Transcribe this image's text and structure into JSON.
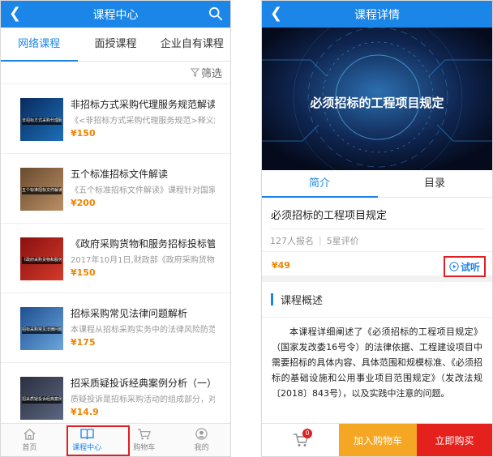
{
  "left": {
    "header": {
      "title": "课程中心"
    },
    "tabs": [
      {
        "label": "网络课程"
      },
      {
        "label": "面授课程"
      },
      {
        "label": "企业自有课程"
      }
    ],
    "filter_label": "筛选",
    "courses": [
      {
        "title": "非招标方式采购代理服务规范解读（",
        "desc": "《<非招标方式采购代理服务规范>释义解",
        "price": "¥150",
        "thumb_caption": "非招标方式采购代理服务规范解读（二）",
        "thumb_colors": [
          "#0a2a5e",
          "#1d6fb8"
        ]
      },
      {
        "title": "五个标准招标文件解读",
        "desc": "《五个标准招标文件解读》课程针对国家发",
        "price": "¥200",
        "thumb_caption": "五个标准招标文件解读",
        "thumb_colors": [
          "#6b4a2e",
          "#b89067"
        ]
      },
      {
        "title": "《政府采购货物和服务招标投标管理",
        "desc": "2017年10月1日,财政部《政府采购货物和服",
        "price": "¥150",
        "thumb_caption": "《政府采购货物和服务招标投标管理办法》解读",
        "thumb_colors": [
          "#8a1010",
          "#d43a2a"
        ]
      },
      {
        "title": "招标采购常见法律问题解析",
        "desc": "本课程从招标采购实务中的法律风险防范和",
        "price": "¥175",
        "thumb_caption": "招标采购常见法律问题解析",
        "thumb_colors": [
          "#1e4f8f",
          "#6aa6dd"
        ]
      },
      {
        "title": "招采质疑投诉经典案例分析（一）",
        "desc": "质疑投诉是招标采购活动的组成部分，对于",
        "price": "¥14.9",
        "thumb_caption": "招采质疑投诉经典案例分析（一）",
        "thumb_colors": [
          "#2b2f40",
          "#5c6780"
        ]
      }
    ],
    "bottom_nav": [
      {
        "label": "首页",
        "icon": "home-icon"
      },
      {
        "label": "课程中心",
        "icon": "book-icon"
      },
      {
        "label": "购物车",
        "icon": "cart-icon"
      },
      {
        "label": "我的",
        "icon": "user-icon"
      }
    ]
  },
  "right": {
    "header": {
      "title": "课程详情"
    },
    "banner_title": "必须招标的工程项目规定",
    "tabs": [
      {
        "label": "简介"
      },
      {
        "label": "目录"
      }
    ],
    "course_title": "必须招标的工程项目规定",
    "enrolled": "127人报名",
    "rating": "5星评价",
    "price": "¥49",
    "trial_label": "试听",
    "overview_heading": "课程概述",
    "overview_text": "本课程详细阐述了《必须招标的工程项目规定》（国家发改委16号令）的法律依据、工程建设项目中需要招标的具体内容、具体范围和规模标准、《必须招标的基础设施和公用事业项目范围规定》（发改法规〔2018〕843号），以及实践中注意的问题。",
    "cart_count": "0",
    "add_to_cart": "加入购物车",
    "buy_now": "立即购买"
  },
  "colors": {
    "primary": "#1b86e8",
    "price": "#f08300",
    "highlight_box": "#e02020",
    "add_to_cart_bg": "#f5a623",
    "buy_now_bg": "#e5211d"
  }
}
